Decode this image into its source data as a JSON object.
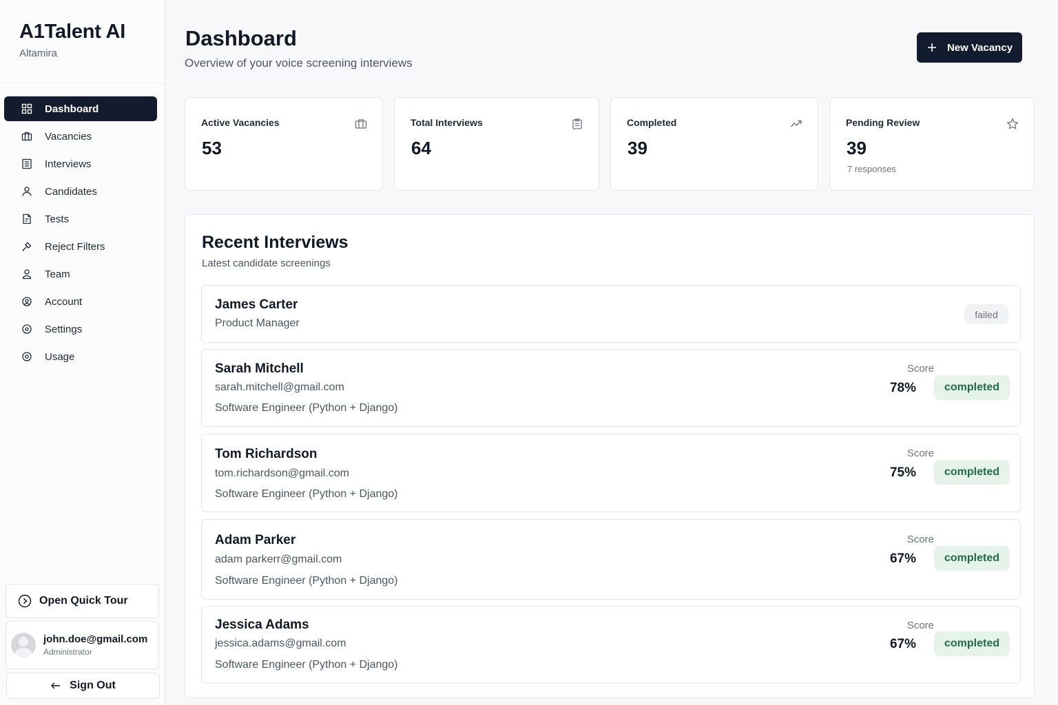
{
  "brand": {
    "title": "A1Talent AI",
    "org": "Altamira"
  },
  "nav": [
    {
      "label": "Dashboard",
      "icon": "dashboard-grid-icon",
      "active": true
    },
    {
      "label": "Vacancies",
      "icon": "briefcase-icon"
    },
    {
      "label": "Interviews",
      "icon": "list-icon"
    },
    {
      "label": "Candidates",
      "icon": "user-icon"
    },
    {
      "label": "Tests",
      "icon": "document-icon"
    },
    {
      "label": "Reject Filters",
      "icon": "filter-tool-icon"
    },
    {
      "label": "Team",
      "icon": "team-icon"
    },
    {
      "label": "Account",
      "icon": "account-icon"
    },
    {
      "label": "Settings",
      "icon": "settings-icon"
    },
    {
      "label": "Usage",
      "icon": "usage-icon"
    }
  ],
  "sidebar_bottom": {
    "tour_label": "Open Quick Tour",
    "user_email": "john.doe@gmail.com",
    "user_role": "Administrator",
    "signout_label": "Sign Out"
  },
  "header": {
    "title": "Dashboard",
    "subtitle": "Overview of your voice screening interviews",
    "new_button": "New Vacancy"
  },
  "stats": [
    {
      "label": "Active Vacancies",
      "value": "53",
      "icon": "briefcase-icon"
    },
    {
      "label": "Total Interviews",
      "value": "64",
      "icon": "clipboard-icon"
    },
    {
      "label": "Completed",
      "value": "39",
      "icon": "trending-up-icon"
    },
    {
      "label": "Pending Review",
      "value": "39",
      "note": "7 responses",
      "icon": "star-icon"
    }
  ],
  "recent": {
    "title": "Recent Interviews",
    "subtitle": "Latest candidate screenings",
    "score_label": "Score",
    "rows": [
      {
        "name": "James Carter",
        "role": "Product Manager",
        "status": "failed"
      },
      {
        "name": "Sarah Mitchell",
        "email": "sarah.mitchell@gmail.com",
        "role": "Software Engineer (Python + Django)",
        "score": "78%",
        "status": "completed"
      },
      {
        "name": "Tom Richardson",
        "email": "tom.richardson@gmail.com",
        "role": "Software Engineer (Python + Django)",
        "score": "75%",
        "status": "completed"
      },
      {
        "name": "Adam Parker",
        "email": "adam parkerr@gmail.com",
        "role": "Software Engineer (Python + Django)",
        "score": "67%",
        "status": "completed"
      },
      {
        "name": "Jessica Adams",
        "email": "jessica.adams@gmail.com",
        "role": "Software Engineer (Python + Django)",
        "score": "67%",
        "status": "completed"
      }
    ]
  },
  "colors": {
    "primary": "#131b2e",
    "success_bg": "#e6f3ea",
    "success_text": "#1f6b45",
    "muted_bg": "#f1f2f4"
  }
}
